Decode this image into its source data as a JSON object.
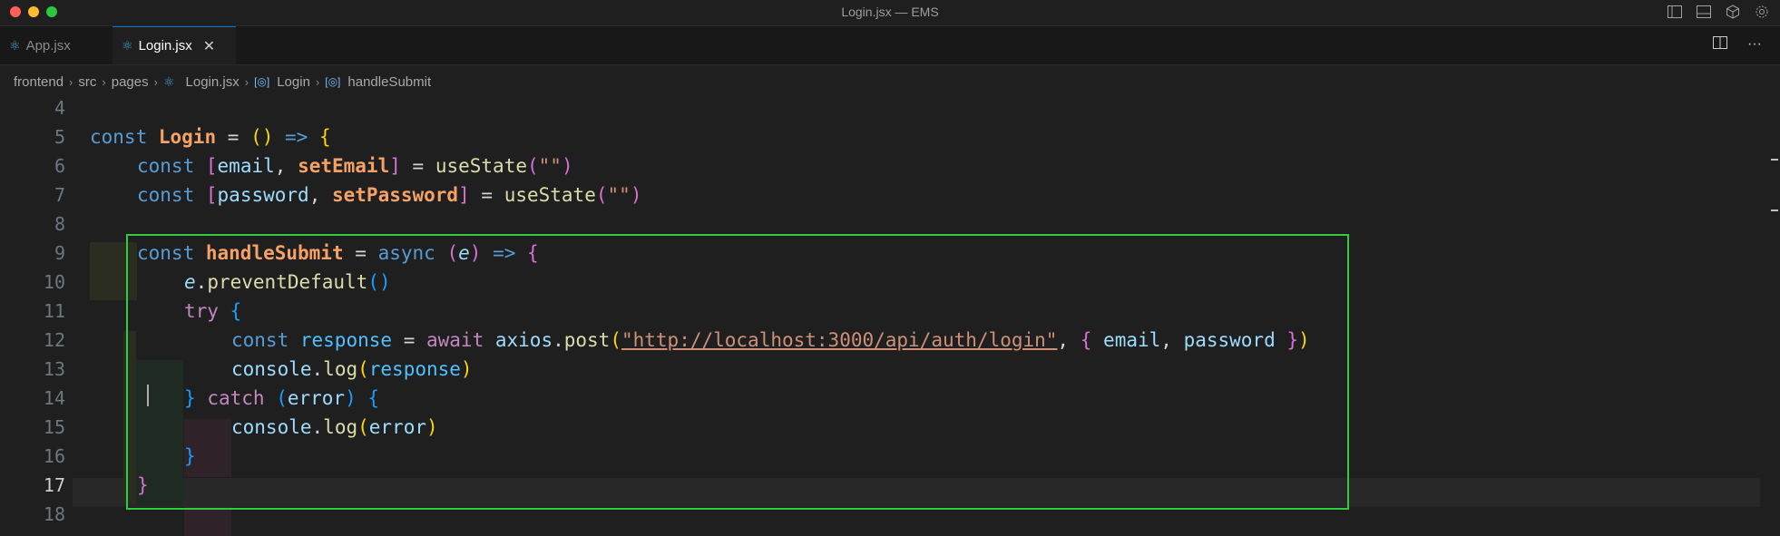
{
  "window": {
    "title": "Login.jsx — EMS"
  },
  "tabs": [
    {
      "label": "App.jsx",
      "icon": "react-icon"
    },
    {
      "label": "Login.jsx",
      "icon": "react-icon",
      "active": true
    }
  ],
  "breadcrumb": [
    "frontend",
    "src",
    "pages",
    "Login.jsx",
    "Login",
    "handleSubmit"
  ],
  "editor": {
    "line_numbers": [
      "4",
      "5",
      "6",
      "7",
      "8",
      "9",
      "10",
      "11",
      "12",
      "13",
      "14",
      "15",
      "16",
      "17",
      "18"
    ],
    "active_line": "17",
    "lines": {
      "l5": [
        "const",
        "Login",
        "=",
        "()",
        "=>",
        "{"
      ],
      "l6": [
        "const",
        "[",
        "email",
        ",",
        "setEmail",
        "]",
        "=",
        "useState",
        "(",
        "\"\"",
        ")"
      ],
      "l7": [
        "const",
        "[",
        "password",
        ",",
        "setPassword",
        "]",
        "=",
        "useState",
        "(",
        "\"\"",
        ")"
      ],
      "l9": [
        "const",
        "handleSubmit",
        "=",
        "async",
        "(",
        "e",
        ")",
        "=>",
        "{"
      ],
      "l10": [
        "e",
        ".",
        "preventDefault",
        "()"
      ],
      "l11": [
        "try",
        "{"
      ],
      "l12": [
        "const",
        "response",
        "=",
        "await",
        "axios",
        ".",
        "post",
        "(",
        "\"http://localhost:3000/api/auth/login\"",
        ",",
        "{",
        "email",
        ",",
        "password",
        "}",
        ")"
      ],
      "l13": [
        "console",
        ".",
        "log",
        "(",
        "response",
        ")"
      ],
      "l14": [
        "}",
        "catch",
        "(",
        "error",
        ")",
        "{"
      ],
      "l15": [
        "console",
        ".",
        "log",
        "(",
        "error",
        ")"
      ],
      "l16": [
        "}"
      ],
      "l17": [
        "}"
      ]
    }
  },
  "colors": {
    "highlight_box": "#2ecc40",
    "accent": "#0078d4"
  }
}
